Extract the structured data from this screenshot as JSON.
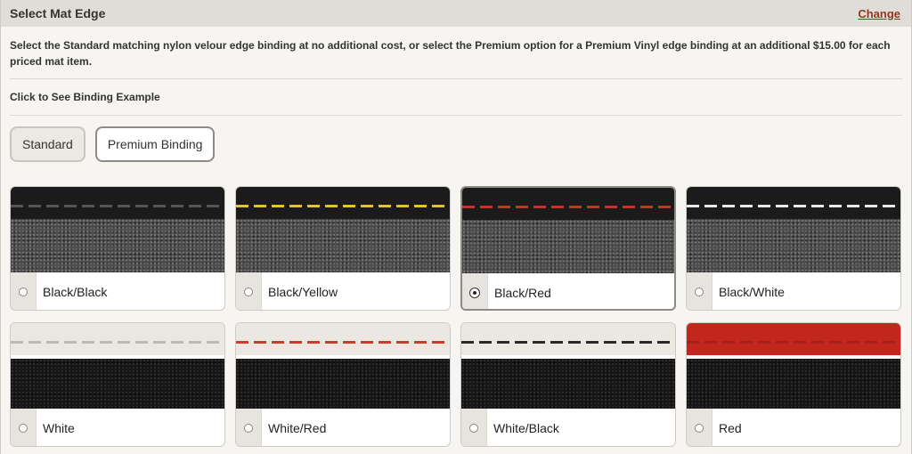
{
  "header": {
    "title": "Select Mat Edge",
    "change_label": "Change"
  },
  "description": "Select the Standard matching nylon velour edge binding at no additional cost, or select the Premium option for a  Premium Vinyl edge binding at an additional $15.00 for each priced mat item.",
  "example_link": "Click to See Binding Example",
  "tabs": [
    {
      "label": "Standard",
      "active": false
    },
    {
      "label": "Premium Binding",
      "active": true
    }
  ],
  "options": [
    {
      "label": "Black/Black",
      "selected": false,
      "binding_color": "#1b1b1b",
      "stitch_color": "#555555",
      "carpet_color": "#4a4a4a"
    },
    {
      "label": "Black/Yellow",
      "selected": false,
      "binding_color": "#1b1b1b",
      "stitch_color": "#e3c235",
      "carpet_color": "#4a4a4a"
    },
    {
      "label": "Black/Red",
      "selected": true,
      "binding_color": "#1b1b1b",
      "stitch_color": "#c8342a",
      "carpet_color": "#4a4a4a"
    },
    {
      "label": "Black/White",
      "selected": false,
      "binding_color": "#1b1b1b",
      "stitch_color": "#e8e8e8",
      "carpet_color": "#4a4a4a"
    },
    {
      "label": "White",
      "selected": false,
      "binding_color": "#ebe8e2",
      "stitch_color": "#bdbab5",
      "carpet_color": "#151515"
    },
    {
      "label": "White/Red",
      "selected": false,
      "binding_color": "#ebe8e2",
      "stitch_color": "#cc3b2d",
      "carpet_color": "#151515"
    },
    {
      "label": "White/Black",
      "selected": false,
      "binding_color": "#ebe8e2",
      "stitch_color": "#2a2a2a",
      "carpet_color": "#151515"
    },
    {
      "label": "Red",
      "selected": false,
      "binding_color": "#c2261c",
      "stitch_color": "#a52018",
      "carpet_color": "#151515"
    }
  ]
}
